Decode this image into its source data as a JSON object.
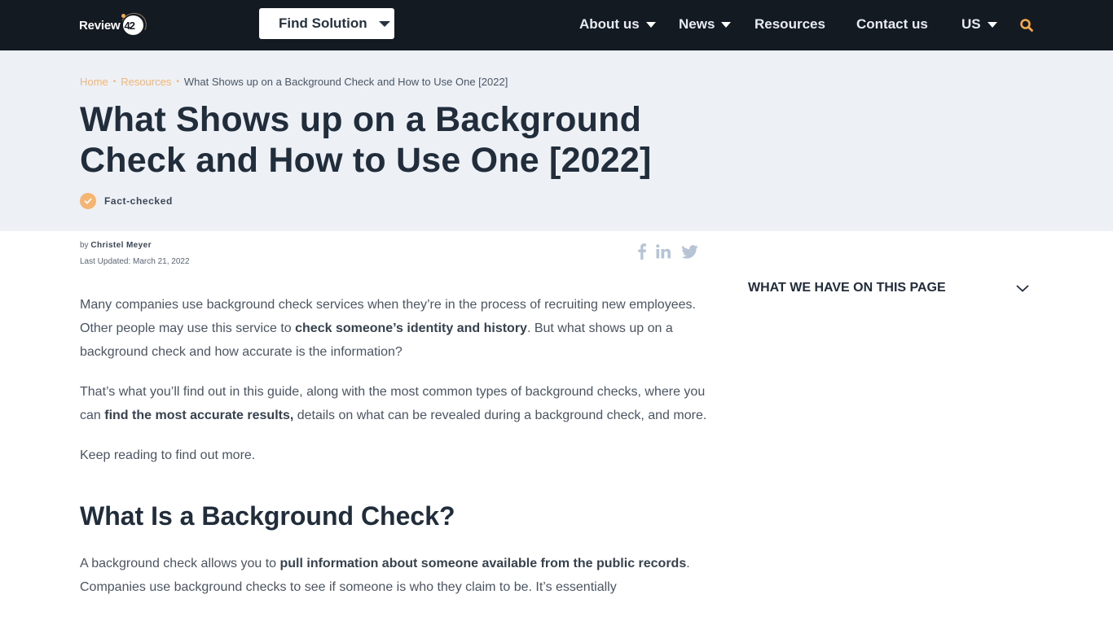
{
  "header": {
    "logo_text": "Review",
    "logo_number": "42",
    "find_solution_label": "Find Solution",
    "nav": [
      {
        "label": "About us",
        "has_dropdown": true
      },
      {
        "label": "News",
        "has_dropdown": true
      },
      {
        "label": "Resources",
        "has_dropdown": false
      },
      {
        "label": "Contact us",
        "has_dropdown": false
      },
      {
        "label": "US",
        "has_dropdown": true
      }
    ],
    "search_icon": "search-icon"
  },
  "breadcrumb": {
    "items": [
      {
        "label": "Home"
      },
      {
        "label": "Resources"
      }
    ],
    "separator": "•",
    "current": "What Shows up on a Background Check and How to Use One [2022]"
  },
  "page_title": "What Shows up on a Background Check and How to Use One [2022]",
  "fact_checked_label": "Fact-checked",
  "meta": {
    "by_prefix": "by",
    "author": "Christel Meyer",
    "last_updated": "Last Updated: March 21, 2022"
  },
  "share": [
    "facebook-icon",
    "linkedin-icon",
    "twitter-icon"
  ],
  "toc": {
    "label": "WHAT WE HAVE ON THIS PAGE"
  },
  "article": {
    "p1": {
      "t1": "Many companies use background check services when they’re in the process of recruiting new employees. Other people may use this service to ",
      "b1": "check someone’s identity and history",
      "t2": ". But what shows up on a background check and how accurate is the information?"
    },
    "p2": {
      "t1": "That’s what you’ll find out in this guide, along with the most common types of background checks, where you can ",
      "b1": "find the most accurate results,",
      "t2": " details on what can be revealed during a background check, and more."
    },
    "p3": "Keep reading to find out more.",
    "h2": "What Is a Background Check?",
    "p4": {
      "t1": "A background check allows you to ",
      "b1": "pull information about someone available from the public records",
      "t2": ". Companies use background checks to see if someone is who they claim to be. It’s essentially"
    }
  },
  "colors": {
    "nav_bg": "#141a22",
    "accent": "#f5b471",
    "hero_bg": "#edf1f6",
    "heading": "#222d3c",
    "body_text": "#4a5563",
    "social_icon": "#b6c4d6"
  }
}
